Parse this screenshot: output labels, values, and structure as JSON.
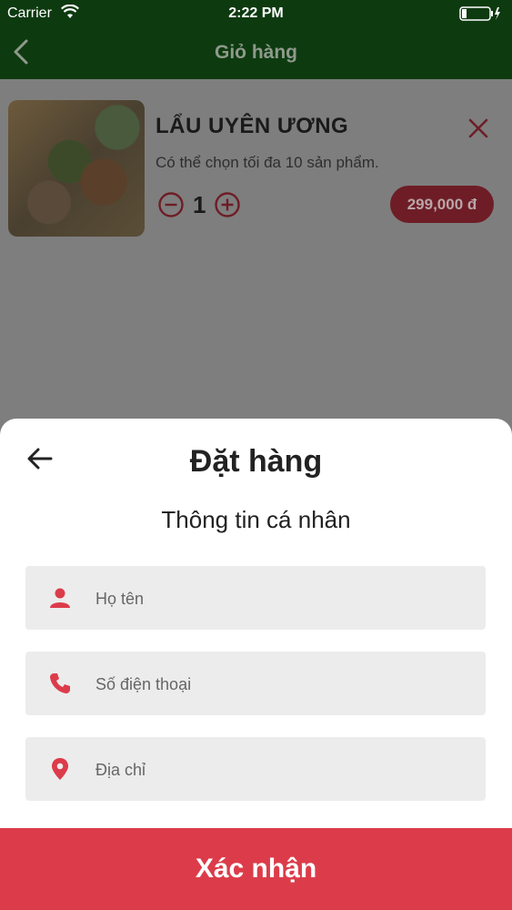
{
  "status_bar": {
    "carrier": "Carrier",
    "time": "2:22 PM"
  },
  "navbar": {
    "title": "Giỏ hàng"
  },
  "cart_item": {
    "name": "LẨU UYÊN ƯƠNG",
    "note": "Có thể chọn tối đa 10 sản phẩm.",
    "quantity": "1",
    "price": "299,000 đ"
  },
  "sheet": {
    "title": "Đặt hàng",
    "subtitle": "Thông tin cá nhân",
    "fields": [
      {
        "icon": "person-icon",
        "placeholder": "Họ tên"
      },
      {
        "icon": "phone-icon",
        "placeholder": "Số điện thoại"
      },
      {
        "icon": "location-pin-icon",
        "placeholder": "Địa chỉ"
      }
    ]
  },
  "submit": {
    "label": "Xác nhận"
  },
  "colors": {
    "header_green": "#0e3a10",
    "accent_red": "#dc3c4a",
    "field_bg": "#ececec",
    "overlay": "#7e7e7e"
  }
}
